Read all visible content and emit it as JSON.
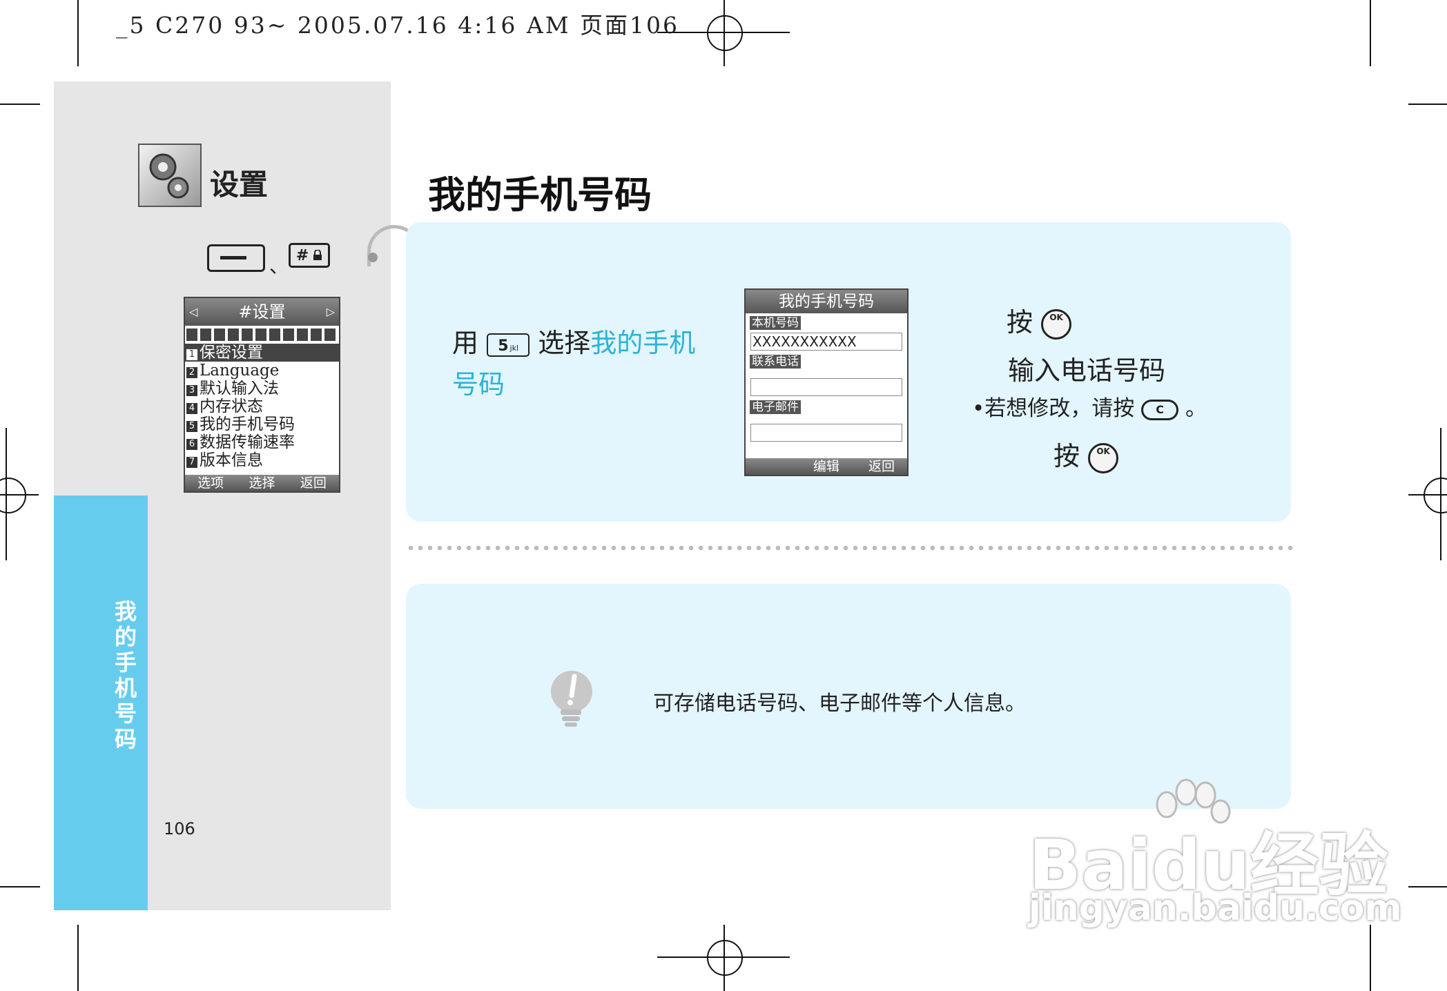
{
  "print_header": "_5 C270 93~ 2005.07.16 4:16 AM 页面106",
  "sidebar": {
    "section_title": "设置",
    "key_separator": "、",
    "key_hash_label": "#",
    "vertical_tab": [
      "我",
      "的",
      "手",
      "机",
      "号",
      "码"
    ],
    "page_number": "106",
    "phone_menu": {
      "title": "#设置",
      "items": [
        {
          "num": "1",
          "label": "保密设置"
        },
        {
          "num": "2",
          "label": "Language"
        },
        {
          "num": "3",
          "label": "默认输入法"
        },
        {
          "num": "4",
          "label": "内存状态"
        },
        {
          "num": "5",
          "label": "我的手机号码"
        },
        {
          "num": "6",
          "label": "数据传输速率"
        },
        {
          "num": "7",
          "label": "版本信息"
        }
      ],
      "softkeys": [
        "选项",
        "选择",
        "返回"
      ]
    }
  },
  "main": {
    "title": "我的手机号码",
    "step1": {
      "prefix": "用",
      "key_label": "5",
      "key_sub": "jkl",
      "middle": "选择",
      "highlight_line1": "我的手机",
      "highlight_line2": "号码"
    },
    "phone_screen": {
      "title": "我的手机号码",
      "field1_label": "本机号码",
      "field1_value": "XXXXXXXXXXX",
      "field2_label": "联系电话",
      "field3_label": "电子邮件",
      "softkeys": [
        "编辑",
        "返回"
      ]
    },
    "step2": {
      "press": "按",
      "ok_label": "OK",
      "instruction": "输入电话号码",
      "bullet": "•",
      "note_prefix": "若想修改，请按",
      "clear_key_label": "C",
      "note_suffix": "。",
      "press2": "按"
    },
    "tip_text": "可存储电话号码、电子邮件等个人信息。"
  },
  "watermark": {
    "brand": "Baidu经验",
    "url": "jingyan.baidu.com"
  }
}
